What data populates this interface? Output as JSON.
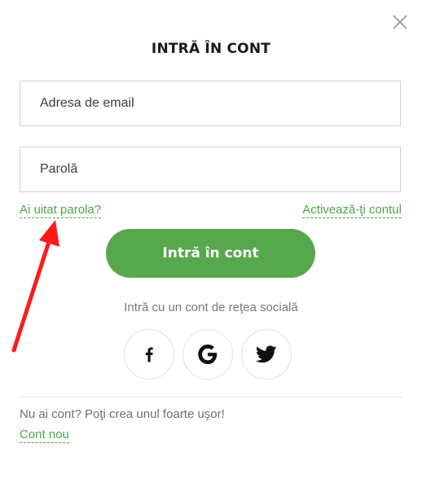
{
  "modal": {
    "title": "INTRĂ ÎN CONT",
    "close_icon": "close-icon"
  },
  "form": {
    "email_placeholder": "Adresa de email",
    "password_placeholder": "Parolă",
    "forgot_password_link": "Ai uitat parola?",
    "activate_account_link": "Activează-ţi contul",
    "login_button": "Intră în cont"
  },
  "social": {
    "caption": "Intră cu un cont de reţea socială",
    "buttons": [
      {
        "icon": "facebook-icon"
      },
      {
        "icon": "google-icon"
      },
      {
        "icon": "twitter-icon"
      }
    ]
  },
  "footer": {
    "no_account_text": "Nu ai cont? Poţi crea unul foarte uşor!",
    "new_account_link": "Cont nou"
  },
  "colors": {
    "accent_green": "#57a84c",
    "link_green": "#4ea44a",
    "annotation_red": "#ff1a1a"
  }
}
